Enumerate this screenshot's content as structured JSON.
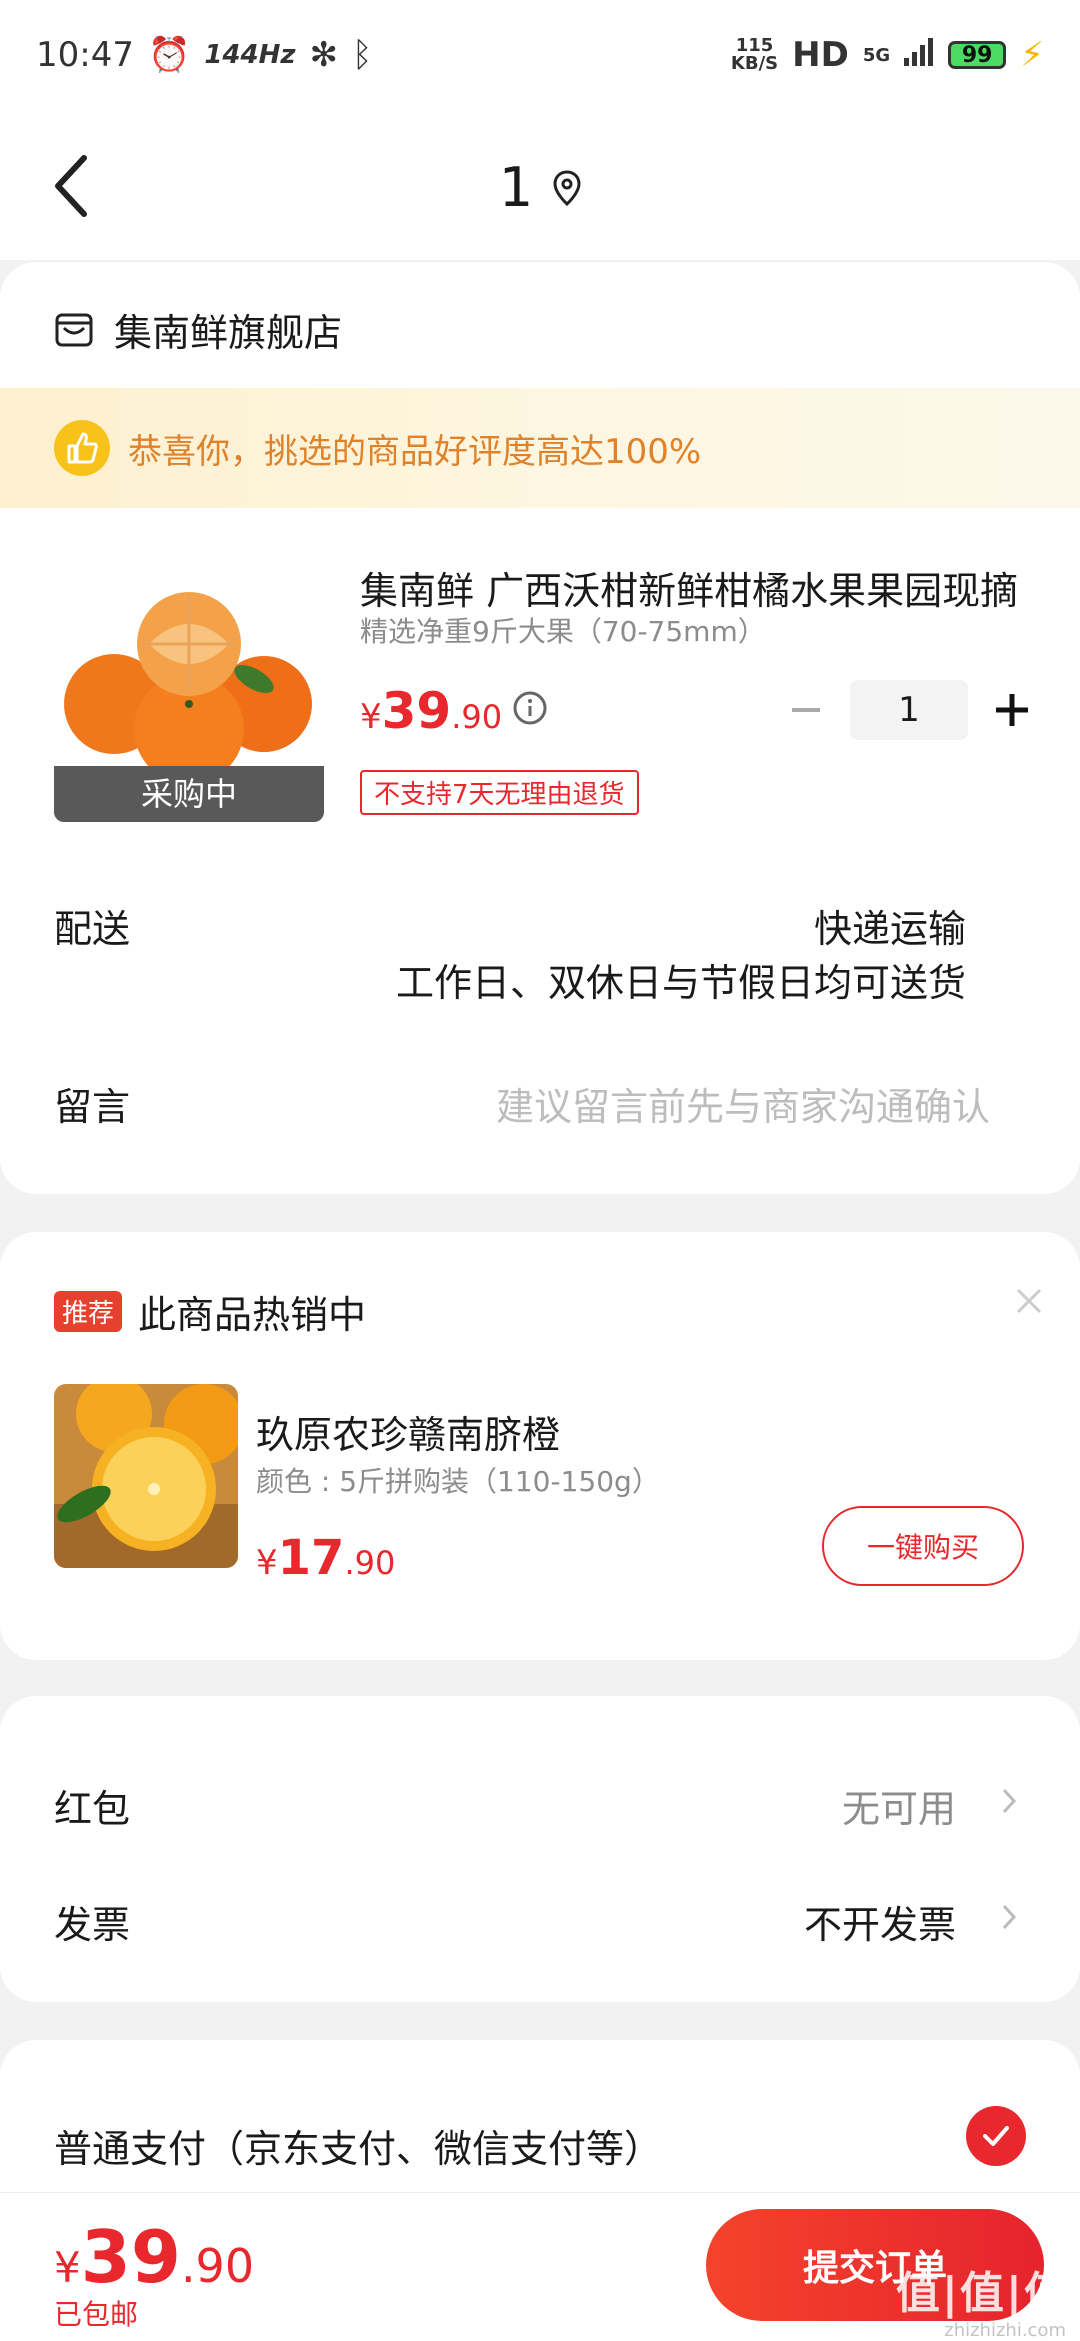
{
  "status_bar": {
    "time": "10:47",
    "refresh_rate": "144Hz",
    "net_speed_value": "115",
    "net_speed_unit": "KB/S",
    "hd": "HD",
    "network": "5G",
    "battery": "99"
  },
  "nav": {
    "title": "1"
  },
  "store": {
    "name": "集南鲜旗舰店"
  },
  "praise": {
    "text": "恭喜你，挑选的商品好评度高达100%"
  },
  "product": {
    "name": "集南鲜 广西沃柑新鲜柑橘水果果园现摘",
    "spec": "精选净重9斤大果（70-75mm）",
    "price_symbol": "¥",
    "price_int": "39",
    "price_dec": ".90",
    "quantity": "1",
    "status_tag": "采购中",
    "return_policy": "不支持7天无理由退货"
  },
  "delivery": {
    "label": "配送",
    "method": "快递运输",
    "note": "工作日、双休日与节假日均可送货"
  },
  "message": {
    "label": "留言",
    "placeholder": "建议留言前先与商家沟通确认"
  },
  "recommendation": {
    "badge": "推荐",
    "title": "此商品热销中",
    "name": "玖原农珍赣南脐橙",
    "spec": "颜色 : 5斤拼购装（110-150g）",
    "price_symbol": "¥",
    "price_int": "17",
    "price_dec": ".90",
    "buy_label": "一键购买"
  },
  "extras": {
    "red_packet_label": "红包",
    "red_packet_value": "无可用",
    "invoice_label": "发票",
    "invoice_value": "不开发票"
  },
  "payment": {
    "label": "普通支付（京东支付、微信支付等）"
  },
  "footer": {
    "price_symbol": "¥",
    "price_int": "39",
    "price_dec": ".90",
    "shipping_note": "已包邮",
    "submit_label": "提交订单"
  },
  "watermark": {
    "text": "值|值|值",
    "url": "zhizhizhi.com"
  },
  "colors": {
    "accent_red": "#e8282d",
    "praise_orange": "#e0822a",
    "thumb_yellow": "#f7c21a"
  }
}
